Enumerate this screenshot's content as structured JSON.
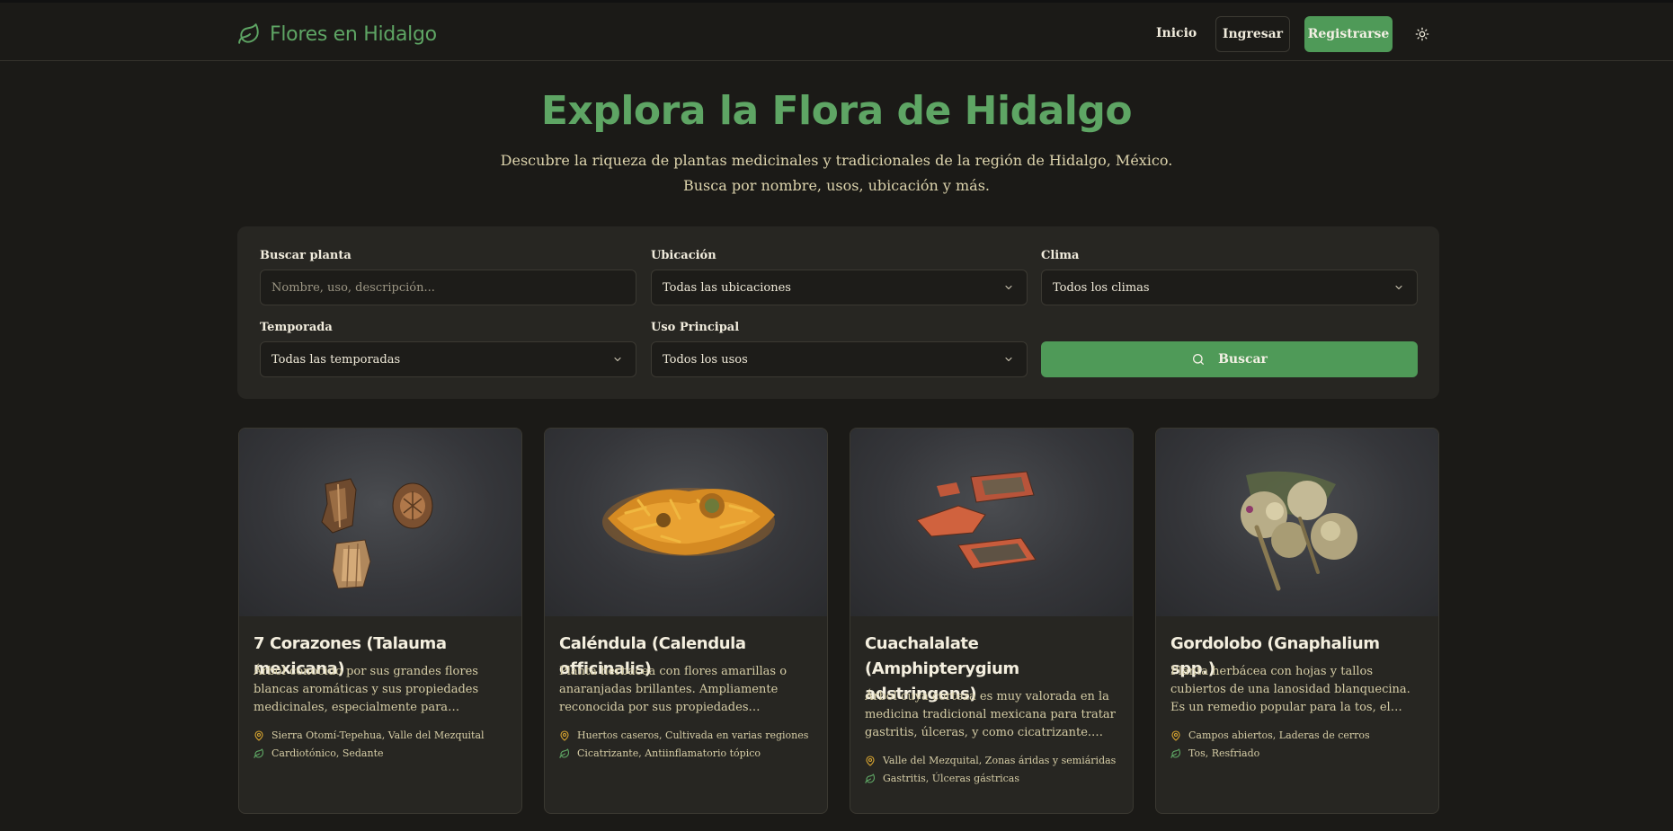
{
  "header": {
    "brand": "Flores en Hidalgo",
    "nav_home": "Inicio",
    "login": "Ingresar",
    "register": "Registrarse"
  },
  "hero": {
    "title": "Explora la Flora de Hidalgo",
    "subtitle_line1": "Descubre la riqueza de plantas medicinales y tradicionales de la región de Hidalgo, México.",
    "subtitle_line2": "Busca por nombre, usos, ubicación y más."
  },
  "filters": {
    "search_label": "Buscar planta",
    "search_placeholder": "Nombre, uso, descripción...",
    "location_label": "Ubicación",
    "location_value": "Todas las ubicaciones",
    "climate_label": "Clima",
    "climate_value": "Todos los climas",
    "season_label": "Temporada",
    "season_value": "Todas las temporadas",
    "use_label": "Uso Principal",
    "use_value": "Todos los usos",
    "search_button": "Buscar"
  },
  "plants": [
    {
      "title": "7 Corazones (Talauma mexicana)",
      "description": "Árbol conocido por sus grandes flores blancas aromáticas y sus propiedades medicinales, especialmente para afecciones cardíacas y nerviosas.",
      "location": "Sierra Otomí-Tepehua, Valle del Mezquital",
      "uses": "Cardiotónico, Sedante"
    },
    {
      "title": "Caléndula (Calendula officinalis)",
      "description": "Planta herbácea con flores amarillas o anaranjadas brillantes. Ampliamente reconocida por sus propiedades cicatrizantes, antiinflamatorias y antisépticas.",
      "location": "Huertos caseros, Cultivada en varias regiones",
      "uses": "Cicatrizante, Antiinflamatorio tópico"
    },
    {
      "title": "Cuachalalate (Amphipterygium adstringens)",
      "description": "Árbol cuya corteza es muy valorada en la medicina tradicional mexicana para tratar gastritis, úlceras, y como cicatrizante. Tiene un sabor amargo.",
      "location": "Valle del Mezquital, Zonas áridas y semiáridas",
      "uses": "Gastritis, Úlceras gástricas"
    },
    {
      "title": "Gordolobo (Gnaphalium spp.)",
      "description": "Planta herbácea con hojas y tallos cubiertos de una lanosidad blanquecina. Es un remedio popular para la tos, el resfriado y otras afecciones respiratorias.",
      "location": "Campos abiertos, Laderas de cerros",
      "uses": "Tos, Resfriado"
    }
  ],
  "colors": {
    "accent": "#4f9a58",
    "brand": "#5ea564",
    "background": "#1b1a17",
    "panel": "#272622",
    "location_icon": "#d7a430",
    "leaf_icon": "#5ea564"
  }
}
